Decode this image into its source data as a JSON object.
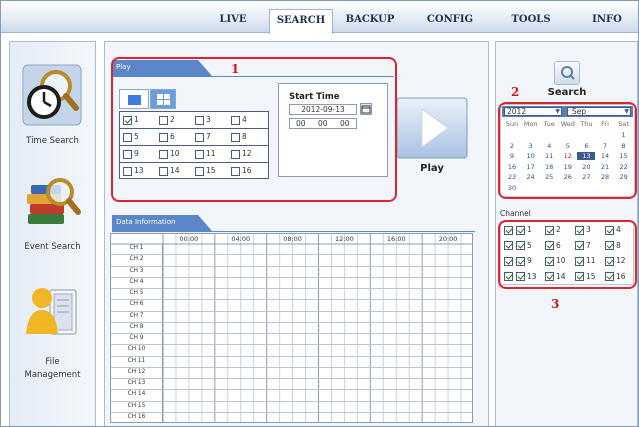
{
  "topnav": {
    "tabs": [
      {
        "label": "LIVE",
        "active": false
      },
      {
        "label": "SEARCH",
        "active": true
      },
      {
        "label": "BACKUP",
        "active": false
      },
      {
        "label": "CONFIG",
        "active": false
      },
      {
        "label": "TOOLS",
        "active": false
      },
      {
        "label": "INFO",
        "active": false
      }
    ]
  },
  "sidebar": {
    "items": [
      {
        "label": "Time Search",
        "icon": "clock-magnifier-icon"
      },
      {
        "label": "Event Search",
        "icon": "books-magnifier-icon"
      },
      {
        "label": "File",
        "label2": "Management",
        "icon": "user-folder-icon"
      }
    ]
  },
  "play_panel": {
    "header": "Play",
    "channels": [
      "1",
      "2",
      "3",
      "4",
      "5",
      "6",
      "7",
      "8",
      "9",
      "10",
      "11",
      "12",
      "13",
      "14",
      "15",
      "16"
    ],
    "checked": [
      true,
      false,
      false,
      false,
      false,
      false,
      false,
      false,
      false,
      false,
      false,
      false,
      false,
      false,
      false,
      false
    ],
    "start_time": {
      "label": "Start Time",
      "date": "2012-09-13",
      "hour": "00",
      "minute": "00",
      "second": "00"
    },
    "play_label": "Play"
  },
  "data_panel": {
    "header": "Data Information",
    "hours": [
      "00:00",
      "04:00",
      "08:00",
      "12:00",
      "16:00",
      "20:00"
    ],
    "rows": [
      "CH 1",
      "CH 2",
      "CH 3",
      "CH 4",
      "CH 5",
      "CH 6",
      "CH 7",
      "CH 8",
      "CH 9",
      "CH 10",
      "CH 11",
      "CH 12",
      "CH 13",
      "CH 14",
      "CH 15",
      "CH 16"
    ]
  },
  "right_panel": {
    "search_label": "Search",
    "calendar": {
      "year": "2012",
      "month": "Sep",
      "weekdays": [
        "Sun",
        "Mon",
        "Tue",
        "Wed",
        "Thu",
        "Fri",
        "Sat"
      ],
      "weeks": [
        [
          "",
          "",
          "",
          "",
          "",
          "",
          "1"
        ],
        [
          "2",
          "3",
          "4",
          "5",
          "6",
          "7",
          "8"
        ],
        [
          "9",
          "10",
          "11",
          "12",
          "13",
          "14",
          "15"
        ],
        [
          "16",
          "17",
          "18",
          "19",
          "20",
          "21",
          "22"
        ],
        [
          "23",
          "24",
          "25",
          "26",
          "27",
          "28",
          "29"
        ],
        [
          "30",
          "",
          "",
          "",
          "",
          "",
          ""
        ]
      ],
      "selected_day": "13",
      "highlight_days": [
        "12",
        "13"
      ]
    },
    "channel_label": "Channel",
    "channels": [
      "1",
      "2",
      "3",
      "4",
      "5",
      "6",
      "7",
      "8",
      "9",
      "10",
      "11",
      "12",
      "13",
      "14",
      "15",
      "16"
    ]
  },
  "annotations": [
    "1",
    "2",
    "3"
  ],
  "colors": {
    "accent": "#5b86c9",
    "annotation_red": "#e0242b",
    "calendar_red": "#d9141b"
  }
}
